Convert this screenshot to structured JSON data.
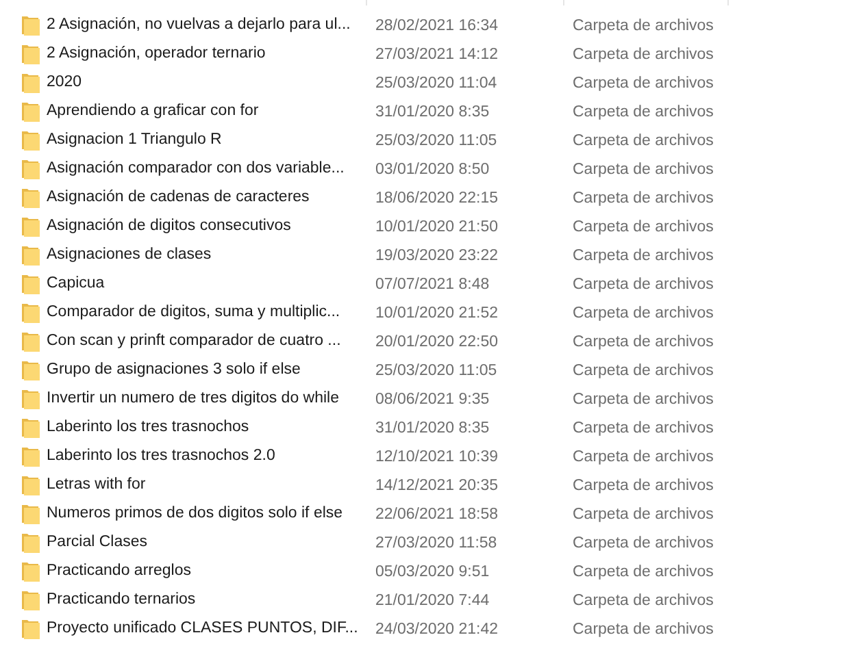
{
  "rows": [
    {
      "name": "2 Asignación, no vuelvas a dejarlo para ul...",
      "date": "28/02/2021 16:34",
      "type": "Carpeta de archivos"
    },
    {
      "name": "2 Asignación, operador ternario",
      "date": "27/03/2021 14:12",
      "type": "Carpeta de archivos"
    },
    {
      "name": "2020",
      "date": "25/03/2020 11:04",
      "type": "Carpeta de archivos"
    },
    {
      "name": "Aprendiendo a graficar con for",
      "date": "31/01/2020 8:35",
      "type": "Carpeta de archivos"
    },
    {
      "name": "Asignacion 1 Triangulo R",
      "date": "25/03/2020 11:05",
      "type": "Carpeta de archivos"
    },
    {
      "name": "Asignación comparador con dos variable...",
      "date": "03/01/2020 8:50",
      "type": "Carpeta de archivos"
    },
    {
      "name": "Asignación de cadenas de caracteres",
      "date": "18/06/2020 22:15",
      "type": "Carpeta de archivos"
    },
    {
      "name": "Asignación de digitos consecutivos",
      "date": "10/01/2020 21:50",
      "type": "Carpeta de archivos"
    },
    {
      "name": "Asignaciones de clases",
      "date": "19/03/2020 23:22",
      "type": "Carpeta de archivos"
    },
    {
      "name": "Capicua",
      "date": "07/07/2021 8:48",
      "type": "Carpeta de archivos"
    },
    {
      "name": "Comparador de digitos, suma y multiplic...",
      "date": "10/01/2020 21:52",
      "type": "Carpeta de archivos"
    },
    {
      "name": "Con scan y prinft comparador de cuatro ...",
      "date": "20/01/2020 22:50",
      "type": "Carpeta de archivos"
    },
    {
      "name": "Grupo de asignaciones 3 solo if else",
      "date": "25/03/2020 11:05",
      "type": "Carpeta de archivos"
    },
    {
      "name": "Invertir un numero de tres digitos do while",
      "date": "08/06/2021 9:35",
      "type": "Carpeta de archivos"
    },
    {
      "name": "Laberinto los tres trasnochos",
      "date": "31/01/2020 8:35",
      "type": "Carpeta de archivos"
    },
    {
      "name": "Laberinto los tres trasnochos 2.0",
      "date": "12/10/2021 10:39",
      "type": "Carpeta de archivos"
    },
    {
      "name": "Letras with for",
      "date": "14/12/2021 20:35",
      "type": "Carpeta de archivos"
    },
    {
      "name": "Numeros primos de dos digitos solo if else",
      "date": "22/06/2021 18:58",
      "type": "Carpeta de archivos"
    },
    {
      "name": "Parcial Clases",
      "date": "27/03/2020 11:58",
      "type": "Carpeta de archivos"
    },
    {
      "name": "Practicando arreglos",
      "date": "05/03/2020 9:51",
      "type": "Carpeta de archivos"
    },
    {
      "name": "Practicando ternarios",
      "date": "21/01/2020 7:44",
      "type": "Carpeta de archivos"
    },
    {
      "name": "Proyecto unificado CLASES PUNTOS, DIF...",
      "date": "24/03/2020 21:42",
      "type": "Carpeta de archivos"
    }
  ]
}
